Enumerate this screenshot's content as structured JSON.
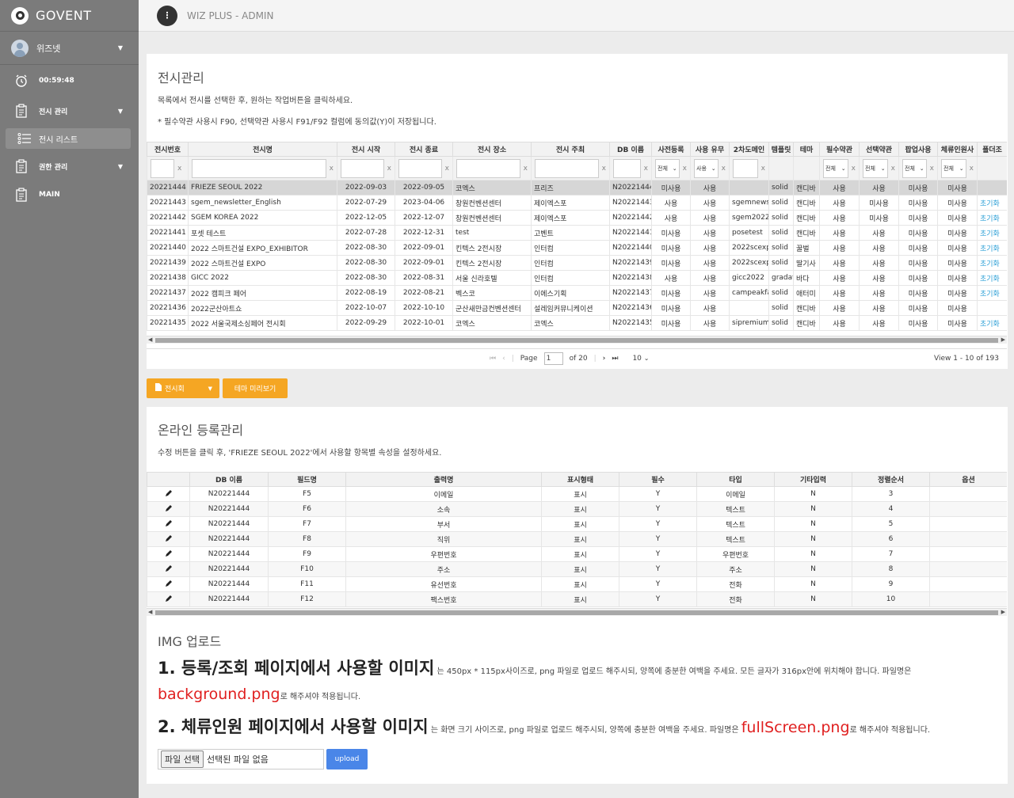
{
  "brand": "GOVENT",
  "sidebar": {
    "user": "위즈넷",
    "timer": "00:59:48",
    "items": [
      {
        "label": "전시 관리"
      },
      {
        "label": "전시 리스트"
      },
      {
        "label": "권한 관리"
      },
      {
        "label": "MAIN"
      }
    ]
  },
  "topbar": {
    "title": "WIZ PLUS - ADMIN"
  },
  "exhibit": {
    "title": "전시관리",
    "desc1": "목록에서 전시를 선택한 후, 원하는 작업버튼을 클릭하세요.",
    "desc2": "* 필수약관 사용시 F90, 선택약관 사용시 F91/F92 컬럼에 동의값(Y)이 저장됩니다.",
    "columns": [
      "전시번호",
      "전시명",
      "전시 시작",
      "전시 종료",
      "전시 장소",
      "전시 주최",
      "DB 이름",
      "사전등록",
      "사용 유무",
      "2차도메인",
      "템플릿",
      "테마",
      "필수약관",
      "선택약관",
      "팝업사용",
      "체류인원사",
      "폴더조"
    ],
    "filter_x": "x",
    "filter_all": "전체",
    "filter_use": "사용",
    "rows": [
      [
        "20221444",
        "FRIEZE SEOUL 2022",
        "2022-09-03",
        "2022-09-05",
        "코엑스",
        "프리즈",
        "N20221444",
        "미사용",
        "사용",
        "",
        "solid",
        "캔디바",
        "사용",
        "사용",
        "미사용",
        "미사용",
        ""
      ],
      [
        "20221443",
        "sgem_newsletter_English",
        "2022-07-29",
        "2023-04-06",
        "창원컨벤션센터",
        "제이엑스포",
        "N20221443",
        "사용",
        "사용",
        "sgemnews",
        "solid",
        "캔디바",
        "사용",
        "미사용",
        "미사용",
        "미사용",
        "초기화"
      ],
      [
        "20221442",
        "SGEM KOREA 2022",
        "2022-12-05",
        "2022-12-07",
        "창원컨벤션센터",
        "제이엑스포",
        "N20221442",
        "사용",
        "사용",
        "sgem2022",
        "solid",
        "캔디바",
        "사용",
        "미사용",
        "미사용",
        "미사용",
        "초기화"
      ],
      [
        "20221441",
        "포셋 테스트",
        "2022-07-28",
        "2022-12-31",
        "test",
        "고벤트",
        "N20221441",
        "미사용",
        "사용",
        "posetest",
        "solid",
        "캔디바",
        "사용",
        "사용",
        "미사용",
        "미사용",
        "초기화"
      ],
      [
        "20221440",
        "2022 스마트건설 EXPO_EXHIBITOR",
        "2022-08-30",
        "2022-09-01",
        "킨텍스 2전시장",
        "인터컴",
        "N20221440",
        "미사용",
        "사용",
        "2022scexp",
        "solid",
        "꿀벌",
        "사용",
        "사용",
        "미사용",
        "미사용",
        "초기화"
      ],
      [
        "20221439",
        "2022 스마트건설 EXPO",
        "2022-08-30",
        "2022-09-01",
        "킨텍스 2전시장",
        "인터컴",
        "N20221439",
        "미사용",
        "사용",
        "2022scexp",
        "solid",
        "딸기사",
        "사용",
        "사용",
        "미사용",
        "미사용",
        "초기화"
      ],
      [
        "20221438",
        "GICC 2022",
        "2022-08-30",
        "2022-08-31",
        "서울 신라호텔",
        "인터컴",
        "N20221438",
        "사용",
        "사용",
        "gicc2022",
        "gradat",
        "바다",
        "사용",
        "사용",
        "미사용",
        "미사용",
        "초기화"
      ],
      [
        "20221437",
        "2022 캠피크 페어",
        "2022-08-19",
        "2022-08-21",
        "벡스코",
        "이에스기획",
        "N20221437",
        "미사용",
        "사용",
        "campeakfa",
        "solid",
        "애터미",
        "사용",
        "사용",
        "미사용",
        "미사용",
        "초기화"
      ],
      [
        "20221436",
        "2022군산아트쇼",
        "2022-10-07",
        "2022-10-10",
        "군산새만금컨벤션센터",
        "설레임커뮤니케이션",
        "N20221436",
        "미사용",
        "사용",
        "",
        "solid",
        "캔디바",
        "사용",
        "사용",
        "미사용",
        "미사용",
        ""
      ],
      [
        "20221435",
        "2022 서울국제소싱페어 전시회",
        "2022-09-29",
        "2022-10-01",
        "코엑스",
        "코엑스",
        "N20221435",
        "미사용",
        "사용",
        "sipremium",
        "solid",
        "캔디바",
        "사용",
        "사용",
        "미사용",
        "미사용",
        "초기화"
      ]
    ],
    "pager": {
      "page_label": "Page",
      "page": "1",
      "of": "of 20",
      "per_page": "10",
      "view": "View 1 - 10 of 193"
    },
    "buttons": {
      "exhibit": "전시회",
      "theme": "테마 미리보기"
    }
  },
  "online": {
    "title": "온라인 등록관리",
    "desc": "수정 버튼을 클릭 후, 'FRIEZE SEOUL 2022'에서 사용할 항목별 속성을 설정하세요.",
    "columns": [
      "",
      "DB 이름",
      "필드명",
      "출력명",
      "표시형태",
      "필수",
      "타입",
      "기타입력",
      "정렬순서",
      "옵션"
    ],
    "rows": [
      [
        "",
        "N20221444",
        "F5",
        "이메일",
        "표시",
        "Y",
        "이메일",
        "N",
        "3",
        ""
      ],
      [
        "",
        "N20221444",
        "F6",
        "소속",
        "표시",
        "Y",
        "텍스트",
        "N",
        "4",
        ""
      ],
      [
        "",
        "N20221444",
        "F7",
        "부서",
        "표시",
        "Y",
        "텍스트",
        "N",
        "5",
        ""
      ],
      [
        "",
        "N20221444",
        "F8",
        "직위",
        "표시",
        "Y",
        "텍스트",
        "N",
        "6",
        ""
      ],
      [
        "",
        "N20221444",
        "F9",
        "우편번호",
        "표시",
        "Y",
        "우편번호",
        "N",
        "7",
        ""
      ],
      [
        "",
        "N20221444",
        "F10",
        "주소",
        "표시",
        "Y",
        "주소",
        "N",
        "8",
        ""
      ],
      [
        "",
        "N20221444",
        "F11",
        "유선번호",
        "표시",
        "Y",
        "전화",
        "N",
        "9",
        ""
      ],
      [
        "",
        "N20221444",
        "F12",
        "팩스번호",
        "표시",
        "Y",
        "전화",
        "N",
        "10",
        ""
      ]
    ]
  },
  "img": {
    "title": "IMG 업로드",
    "line1_big": "1. 등록/조회 페이지에서 사용할 이미지",
    "line1_small": " 는 450px * 115px사이즈로, png 파일로 업로드 해주시되, 양쪽에 충분한 여백을 주세요. 모든 글자가 316px안에 위치해야 합니다. 파일명은",
    "line1b_red": "background.png",
    "line1b_small": "로 해주셔야 적용됩니다.",
    "line2_big": "2. 체류인원 페이지에서 사용할 이미지",
    "line2_small": " 는 화면 크기 사이즈로, png 파일로 업로드 해주시되, 양쪽에 충분한 여백을 주세요. 파일명은 ",
    "line2_red": "fullScreen.png",
    "line2_tail": "로 해주셔야 적용됩니다.",
    "file_btn": "파일 선택",
    "file_none": "선택된 파일 없음",
    "upload": "upload"
  },
  "colors": {
    "sidebar": "#7b7b7b",
    "accent": "#f5a623",
    "upload": "#4a86e8",
    "link": "#2a9fd6",
    "red": "#e02020"
  }
}
